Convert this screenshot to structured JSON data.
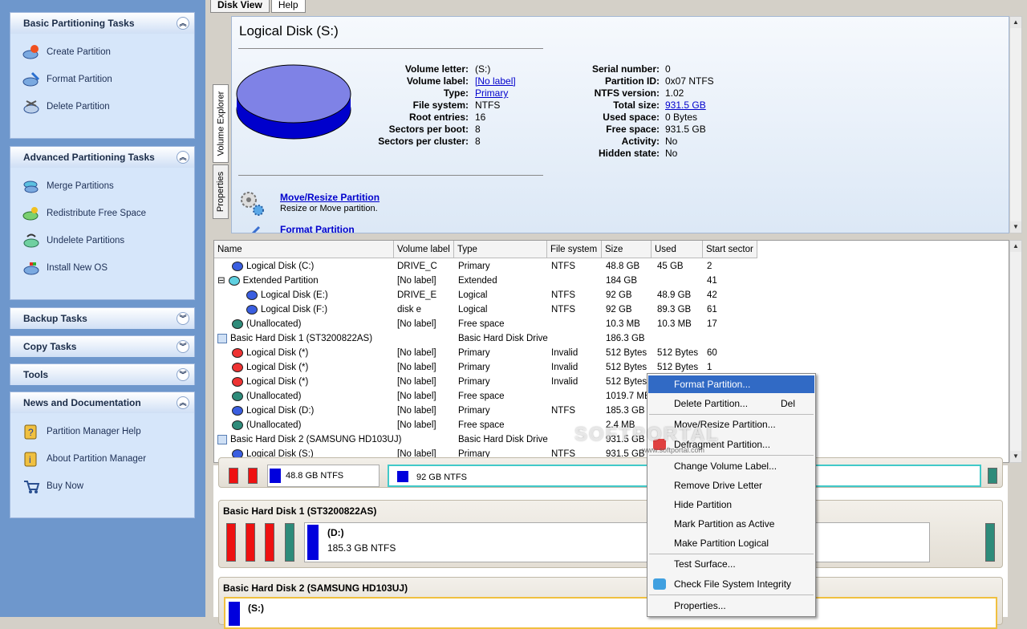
{
  "sidebar": {
    "panels": [
      {
        "title": "Basic Partitioning Tasks",
        "expanded": true,
        "items": [
          "Create Partition",
          "Format Partition",
          "Delete Partition"
        ]
      },
      {
        "title": "Advanced Partitioning Tasks",
        "expanded": true,
        "items": [
          "Merge Partitions",
          "Redistribute Free Space",
          "Undelete Partitions",
          "Install New OS"
        ]
      },
      {
        "title": "Backup Tasks",
        "expanded": false,
        "items": []
      },
      {
        "title": "Copy Tasks",
        "expanded": false,
        "items": []
      },
      {
        "title": "Tools",
        "expanded": false,
        "items": []
      },
      {
        "title": "News and Documentation",
        "expanded": true,
        "items": [
          "Partition Manager Help",
          "About Partition Manager",
          "Buy Now"
        ]
      }
    ]
  },
  "tabs": [
    "Disk View",
    "Help"
  ],
  "vtabs": [
    "Volume Explorer",
    "Properties"
  ],
  "info": {
    "title": "Logical Disk (S:)",
    "left_fields": [
      {
        "k": "Volume letter:",
        "v": "(S:)",
        "link": false
      },
      {
        "k": "Volume label:",
        "v": "[No label]",
        "link": true
      },
      {
        "k": "Type:",
        "v": "Primary",
        "link": true
      },
      {
        "k": "File system:",
        "v": "NTFS",
        "link": false
      },
      {
        "k": "Root entries:",
        "v": "16",
        "link": false
      },
      {
        "k": "Sectors per boot:",
        "v": "8",
        "link": false
      },
      {
        "k": "Sectors per cluster:",
        "v": "8",
        "link": false
      }
    ],
    "right_fields": [
      {
        "k": "Serial number:",
        "v": "0",
        "link": false
      },
      {
        "k": "Partition ID:",
        "v": "0x07 NTFS",
        "link": false
      },
      {
        "k": "NTFS version:",
        "v": "1.02",
        "link": false
      },
      {
        "k": "Total size:",
        "v": "931.5 GB",
        "link": true
      },
      {
        "k": "Used space:",
        "v": "0 Bytes",
        "link": false
      },
      {
        "k": "Free space:",
        "v": "931.5 GB",
        "link": false
      },
      {
        "k": "Activity:",
        "v": "No",
        "link": false
      },
      {
        "k": "Hidden state:",
        "v": "No",
        "link": false
      }
    ],
    "actions": [
      {
        "title": "Move/Resize Partition",
        "desc": "Resize or Move partition."
      },
      {
        "title": "Format Partition",
        "desc": ""
      }
    ]
  },
  "grid": {
    "headers": [
      "Name",
      "Volume label",
      "Type",
      "File system",
      "Size",
      "Used",
      "Start sector"
    ],
    "rows": [
      {
        "indent": 1,
        "icon": "blue",
        "cells": [
          "Logical Disk (C:)",
          "DRIVE_C",
          "Primary",
          "NTFS",
          "48.8 GB",
          "45 GB",
          "2"
        ]
      },
      {
        "indent": 0,
        "icon": "cyan",
        "expander": "⊟",
        "cells": [
          "Extended Partition",
          "[No label]",
          "Extended",
          "",
          "184 GB",
          "",
          "41"
        ]
      },
      {
        "indent": 2,
        "icon": "blue",
        "cells": [
          "Logical Disk (E:)",
          "DRIVE_E",
          "Logical",
          "NTFS",
          "92 GB",
          "48.9 GB",
          "42"
        ]
      },
      {
        "indent": 2,
        "icon": "blue",
        "cells": [
          "Logical Disk (F:)",
          "disk e",
          "Logical",
          "NTFS",
          "92 GB",
          "89.3 GB",
          "61"
        ]
      },
      {
        "indent": 1,
        "icon": "teal",
        "cells": [
          "(Unallocated)",
          "[No label]",
          "Free space",
          "",
          "10.3 MB",
          "10.3 MB",
          "17"
        ]
      },
      {
        "indent": 0,
        "icon": "hd",
        "cells": [
          "Basic Hard Disk 1 (ST3200822AS)",
          "",
          "Basic Hard Disk Drive",
          "",
          "186.3 GB",
          "",
          ""
        ]
      },
      {
        "indent": 1,
        "icon": "red",
        "cells": [
          "Logical Disk (*)",
          "[No label]",
          "Primary",
          "Invalid",
          "512 Bytes",
          "512 Bytes",
          "60"
        ]
      },
      {
        "indent": 1,
        "icon": "red",
        "cells": [
          "Logical Disk (*)",
          "[No label]",
          "Primary",
          "Invalid",
          "512 Bytes",
          "512 Bytes",
          "1"
        ]
      },
      {
        "indent": 1,
        "icon": "red",
        "cells": [
          "Logical Disk (*)",
          "[No label]",
          "Primary",
          "Invalid",
          "512 Bytes",
          "",
          ""
        ]
      },
      {
        "indent": 1,
        "icon": "teal",
        "cells": [
          "(Unallocated)",
          "[No label]",
          "Free space",
          "",
          "1019.7 MB",
          "",
          ""
        ]
      },
      {
        "indent": 1,
        "icon": "blue",
        "cells": [
          "Logical Disk (D:)",
          "[No label]",
          "Primary",
          "NTFS",
          "185.3 GB",
          "",
          ""
        ]
      },
      {
        "indent": 1,
        "icon": "teal",
        "cells": [
          "(Unallocated)",
          "[No label]",
          "Free space",
          "",
          "2.4 MB",
          "",
          ""
        ]
      },
      {
        "indent": 0,
        "icon": "hd",
        "cells": [
          "Basic Hard Disk 2 (SAMSUNG HD103UJ)",
          "",
          "Basic Hard Disk Drive",
          "",
          "931.5 GB",
          "",
          ""
        ]
      },
      {
        "indent": 1,
        "icon": "blue",
        "cells": [
          "Logical Disk (S:)",
          "[No label]",
          "Primary",
          "NTFS",
          "931.5 GB",
          "",
          ""
        ]
      }
    ]
  },
  "map": {
    "top_fragment_left": "48.8 GB NTFS",
    "top_fragment_right": "92 GB NTFS",
    "disk1_title": "Basic Hard Disk 1 (ST3200822AS)",
    "disk1_part_letter": "(D:)",
    "disk1_part_info": "185.3 GB NTFS",
    "disk2_title": "Basic Hard Disk 2 (SAMSUNG HD103UJ)",
    "disk2_part_letter": "(S:)"
  },
  "context_menu": {
    "items": [
      {
        "label": "Format Partition...",
        "shortcut": "",
        "selected": true
      },
      {
        "label": "Delete Partition...",
        "shortcut": "Del",
        "selected": false
      },
      {
        "label": "Move/Resize Partition...",
        "shortcut": "",
        "selected": false
      },
      {
        "label": "Defragment Partition...",
        "shortcut": "",
        "selected": false
      },
      {
        "label": "Change Volume Label...",
        "shortcut": "",
        "selected": false
      },
      {
        "label": "Remove Drive Letter",
        "shortcut": "",
        "selected": false
      },
      {
        "label": "Hide Partition",
        "shortcut": "",
        "selected": false
      },
      {
        "label": "Mark Partition as Active",
        "shortcut": "",
        "selected": false
      },
      {
        "label": "Make Partition Logical",
        "shortcut": "",
        "selected": false
      },
      {
        "label": "Test Surface...",
        "shortcut": "",
        "selected": false
      },
      {
        "label": "Check File System Integrity",
        "shortcut": "",
        "selected": false
      },
      {
        "label": "Properties...",
        "shortcut": "",
        "selected": false
      }
    ]
  },
  "watermark": {
    "main": "SOFTPORTAL",
    "sub": "www.softportal.com"
  },
  "colors": {
    "accent": "#316ac5",
    "sidebar": "#6e97cc",
    "partition_blue": "#0000dd",
    "invalid_red": "#ee1111",
    "free_teal": "#2e8b7a"
  }
}
